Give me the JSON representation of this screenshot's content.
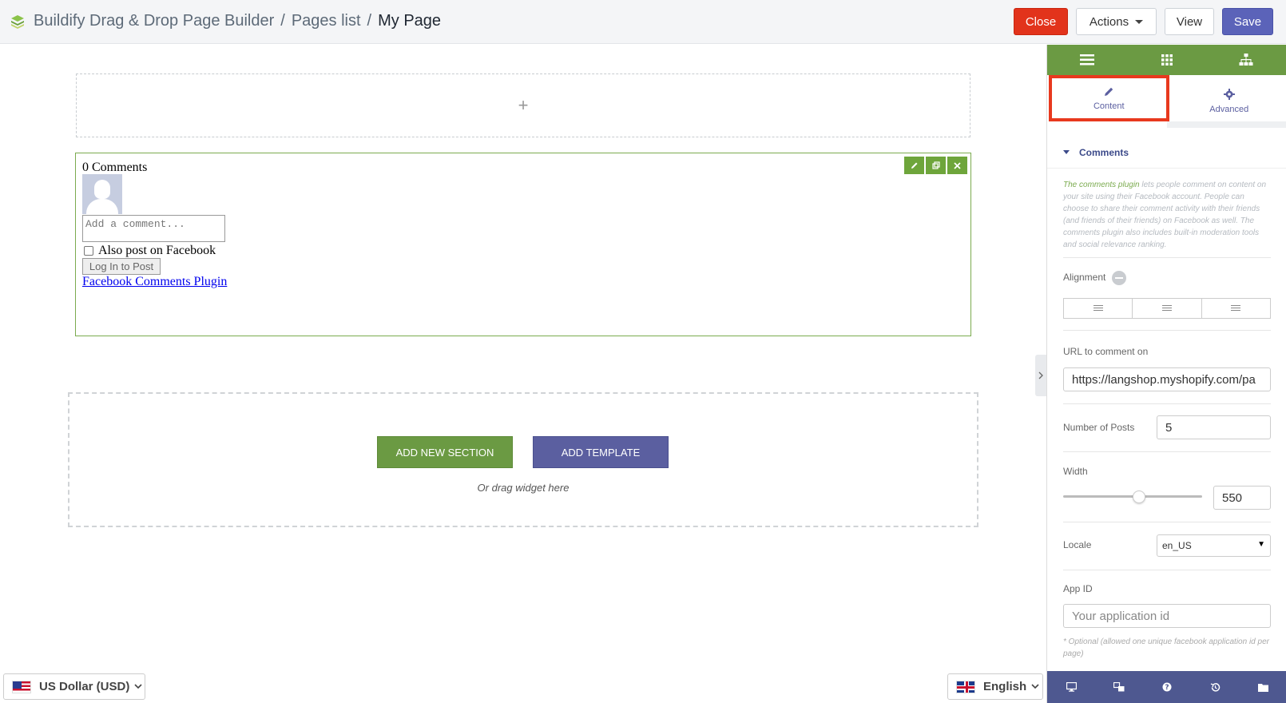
{
  "header": {
    "app_name": "Buildify Drag & Drop Page Builder",
    "sep1": "/",
    "pages_list": "Pages list",
    "sep2": "/",
    "current_page": "My Page",
    "close_label": "Close",
    "actions_label": "Actions",
    "view_label": "View",
    "save_label": "Save"
  },
  "canvas": {
    "add_plus": "+",
    "widget": {
      "comment_count": "0 Comments",
      "comment_placeholder": "Add a comment...",
      "also_post": "Also post on Facebook",
      "login_button": "Log In to Post",
      "plugin_link": "Facebook Comments Plugin"
    },
    "add_section_label": "ADD NEW SECTION",
    "add_template_label": "ADD TEMPLATE",
    "drag_hint": "Or drag widget here"
  },
  "footer": {
    "currency": "US Dollar (USD)",
    "language": "English"
  },
  "panel": {
    "tabs": [
      {
        "label": "Content",
        "icon": "pencil-icon",
        "active": true
      },
      {
        "label": "Advanced",
        "icon": "gear-icon",
        "active": false
      }
    ],
    "section_title": "Comments",
    "description_link": "The comments plugin",
    "description_rest": " lets people comment on content on your site using their Facebook account. People can choose to share their comment activity with their friends (and friends of their friends) on Facebook as well. The comments plugin also includes built-in moderation tools and social relevance ranking.",
    "alignment_label": "Alignment",
    "url_label": "URL to comment on",
    "url_value": "https://langshop.myshopify.com/pa",
    "num_posts_label": "Number of Posts",
    "num_posts_value": "5",
    "width_label": "Width",
    "width_value": "550",
    "locale_label": "Locale",
    "locale_value": "en_US",
    "app_id_label": "App ID",
    "app_id_placeholder": "Your application id",
    "app_id_note": "* Optional (allowed one unique facebook application id per page)"
  },
  "colors": {
    "brand_green": "#6b9a43",
    "brand_purple": "#5b5fa0",
    "close_red": "#e2331b",
    "highlight_border": "#e8391e"
  }
}
